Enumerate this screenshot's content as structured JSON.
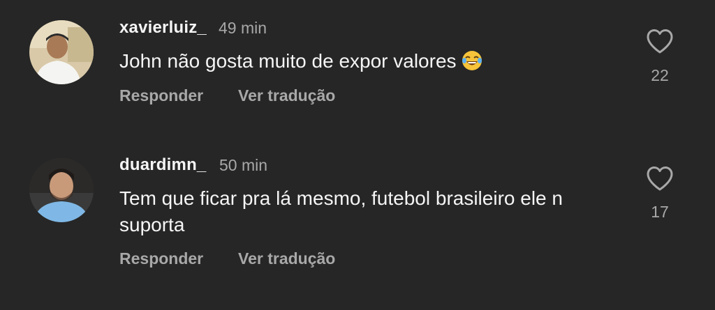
{
  "comments": [
    {
      "username": "xavierluiz_",
      "time": "49 min",
      "text": "John não gosta muito de expor valores",
      "emoji": "😂",
      "reply_label": "Responder",
      "translate_label": "Ver tradução",
      "likes": "22",
      "avatar_icon": "avatar-photo"
    },
    {
      "username": "duardimn_",
      "time": "50 min",
      "text": "Tem que ficar pra lá mesmo, futebol brasileiro ele n suporta",
      "reply_label": "Responder",
      "translate_label": "Ver tradução",
      "likes": "17",
      "avatar_icon": "avatar-photo"
    }
  ],
  "colors": {
    "background": "#262626",
    "primary_text": "#f5f5f5",
    "secondary_text": "#a8a8a8"
  }
}
